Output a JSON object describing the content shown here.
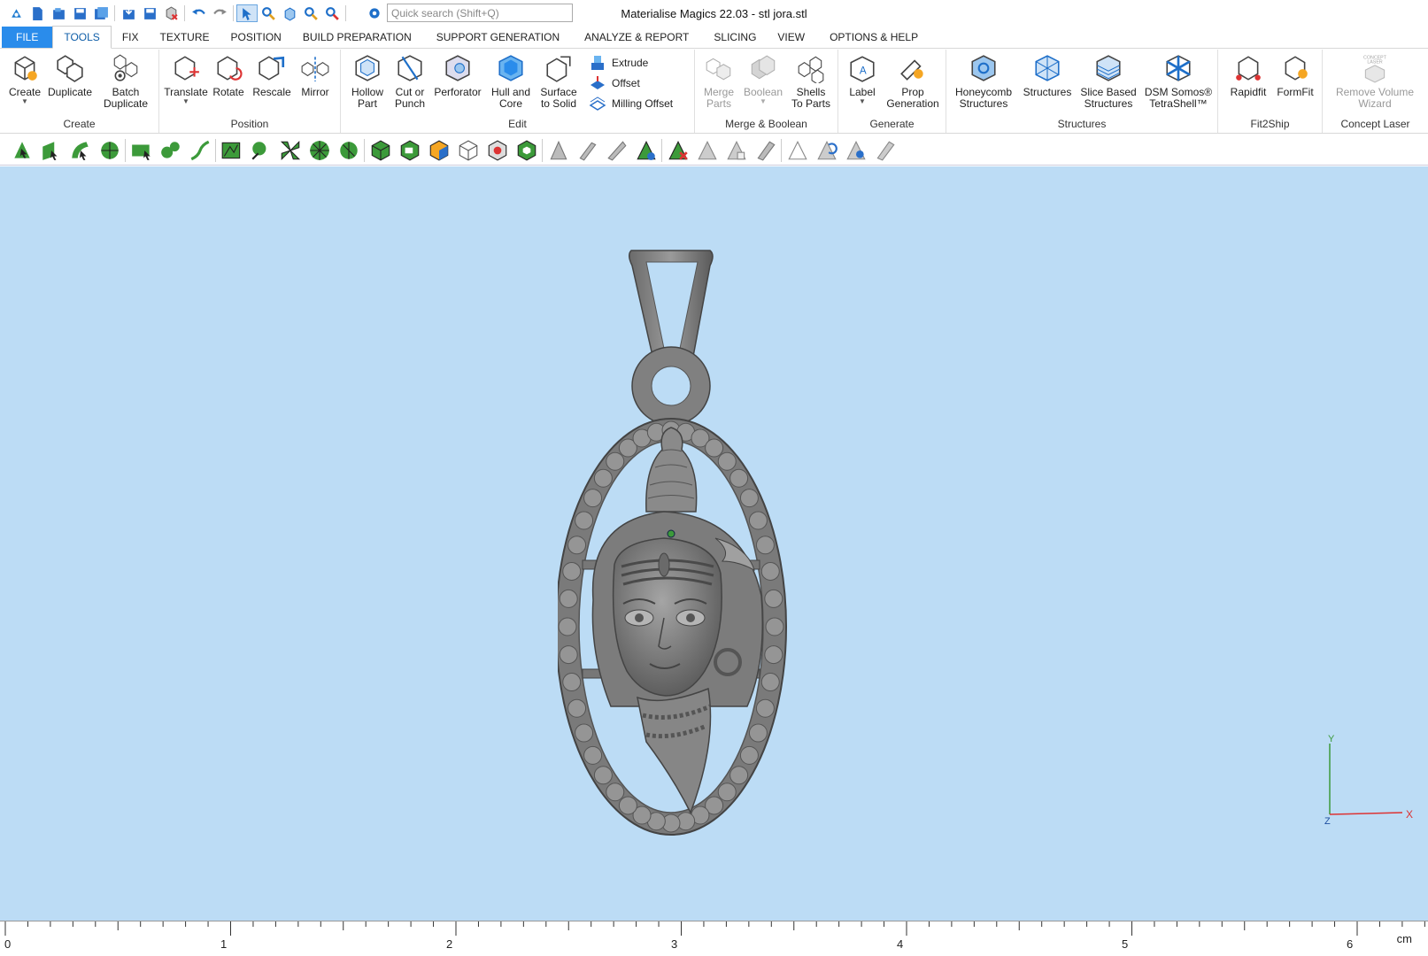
{
  "window": {
    "title": "Materialise Magics 22.03 - stl jora.stl"
  },
  "quick_access": {
    "search_placeholder": "Quick search (Shift+Q)",
    "icons": [
      "app-menu-icon",
      "new-icon",
      "open-icon",
      "save-icon",
      "save-all-icon",
      "import-icon",
      "export-icon",
      "close-part-icon",
      "undo-icon",
      "redo-icon",
      "select-icon",
      "zoom-icon",
      "view-box-icon",
      "zoom-fit-icon",
      "zoom-select-icon",
      "settings-icon"
    ]
  },
  "tabs": [
    "FILE",
    "TOOLS",
    "FIX",
    "TEXTURE",
    "POSITION",
    "BUILD PREPARATION",
    "SUPPORT GENERATION",
    "ANALYZE & REPORT",
    "SLICING",
    "VIEW",
    "OPTIONS & HELP"
  ],
  "active_tab": "TOOLS",
  "ribbon": {
    "create": {
      "label": "Create",
      "buttons": [
        "Create",
        "Duplicate",
        "Batch\nDuplicate"
      ]
    },
    "position": {
      "label": "Position",
      "buttons": [
        "Translate",
        "Rotate",
        "Rescale",
        "Mirror"
      ]
    },
    "edit": {
      "label": "Edit",
      "buttons": [
        "Hollow\nPart",
        "Cut or\nPunch",
        "Perforator",
        "Hull and\nCore",
        "Surface\nto Solid"
      ],
      "small": [
        "Extrude",
        "Offset",
        "Milling Offset"
      ]
    },
    "merge": {
      "label": "Merge & Boolean",
      "buttons": [
        "Merge\nParts",
        "Boolean",
        "Shells\nTo Parts"
      ]
    },
    "generate": {
      "label": "Generate",
      "buttons": [
        "Label",
        "Prop\nGeneration"
      ]
    },
    "structures": {
      "label": "Structures",
      "buttons": [
        "Honeycomb\nStructures",
        "Structures",
        "Slice Based\nStructures",
        "DSM Somos®\nTetraShell™"
      ]
    },
    "fit2ship": {
      "label": "Fit2Ship",
      "buttons": [
        "Rapidfit",
        "FormFit"
      ]
    },
    "concept": {
      "label": "Concept Laser",
      "buttons": [
        "Remove Volume\nWizard"
      ],
      "logo_text": "CONCEPT\nLASER"
    }
  },
  "viewport": {
    "background": "#bcdcf5",
    "axes": {
      "x": "X",
      "y": "Y",
      "z": "Z"
    }
  },
  "ruler": {
    "labels": [
      "0",
      "1",
      "2",
      "3",
      "4",
      "5",
      "6"
    ],
    "unit": "cm"
  },
  "colors": {
    "accent": "#2a8ceb",
    "model": "#7a7a7a",
    "selection_green": "#3c9a3a"
  }
}
